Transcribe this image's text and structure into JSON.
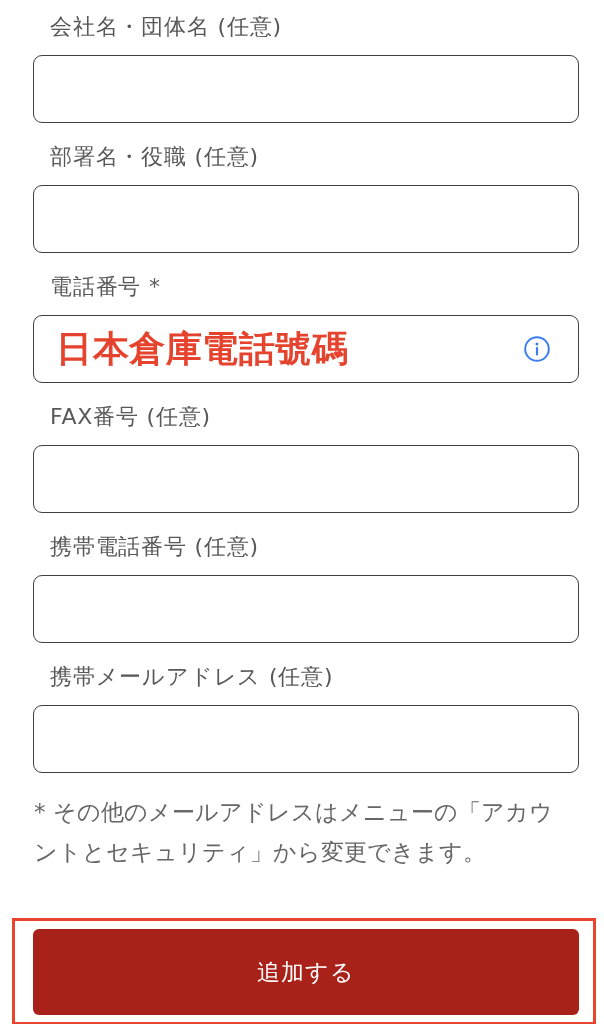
{
  "form": {
    "fields": [
      {
        "label": "会社名・団体名 (任意)",
        "info_icon": false
      },
      {
        "label": "部署名・役職 (任意)",
        "info_icon": false
      },
      {
        "label": "電話番号 *",
        "info_icon": true,
        "annotation": "日本倉庫電話號碼"
      },
      {
        "label": "FAX番号 (任意)",
        "info_icon": false
      },
      {
        "label": "携帯電話番号 (任意)",
        "info_icon": false
      },
      {
        "label": "携帯メールアドレス (任意)",
        "info_icon": false
      }
    ],
    "note": "* その他のメールアドレスはメニューの「アカウントとセキュリティ」から変更できます。",
    "submit_button": {
      "label": "追加する",
      "highlighted": true
    }
  }
}
